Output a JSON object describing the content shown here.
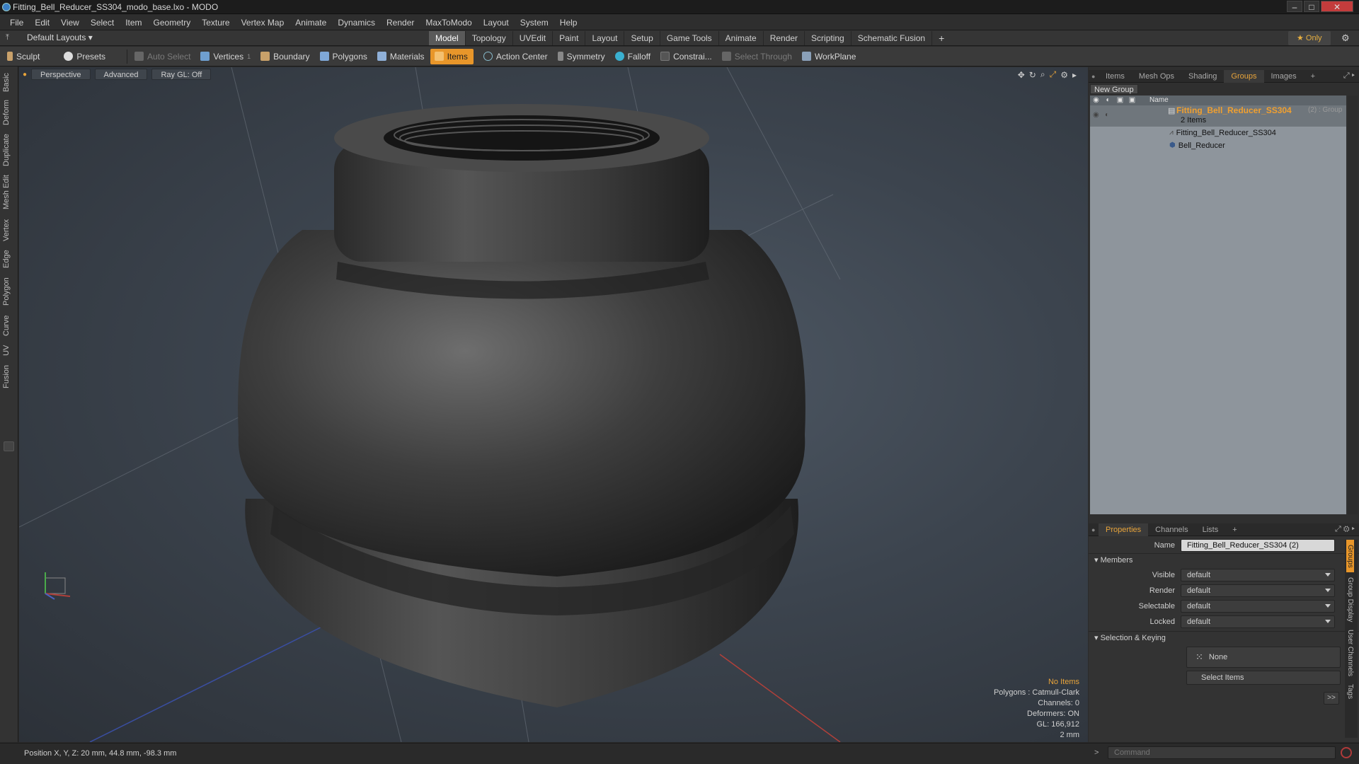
{
  "window": {
    "title": "Fitting_Bell_Reducer_SS304_modo_base.lxo - MODO",
    "min": "–",
    "max": "□",
    "close": "✕"
  },
  "menu": [
    "File",
    "Edit",
    "View",
    "Select",
    "Item",
    "Geometry",
    "Texture",
    "Vertex Map",
    "Animate",
    "Dynamics",
    "Render",
    "MaxToModo",
    "Layout",
    "System",
    "Help"
  ],
  "layoutbar": {
    "preset": "Default Layouts ▾",
    "tabs": [
      "Model",
      "Topology",
      "UVEdit",
      "Paint",
      "Layout",
      "Setup",
      "Game Tools",
      "Animate",
      "Render",
      "Scripting",
      "Schematic Fusion"
    ],
    "active": "Model",
    "plus": "+",
    "only": "★ Only"
  },
  "toolbar": {
    "sculpt": "Sculpt",
    "presets": "Presets",
    "auto_select": "Auto Select",
    "vertices": "Vertices",
    "vertices_badge": "1",
    "boundary": "Boundary",
    "polygons": "Polygons",
    "materials": "Materials",
    "items": "Items",
    "action_center": "Action Center",
    "symmetry": "Symmetry",
    "falloff": "Falloff",
    "constraints": "Constrai...",
    "select_through": "Select Through",
    "workplane": "WorkPlane"
  },
  "left_tabs": [
    "Basic",
    "Deform",
    "Duplicate",
    "Mesh Edit",
    "Vertex",
    "Edge",
    "Polygon",
    "Curve",
    "UV",
    "Fusion"
  ],
  "viewport": {
    "view": "Perspective",
    "shading": "Advanced",
    "raygl": "Ray GL: Off",
    "info": {
      "selection": "No Items",
      "polygons": "Polygons : Catmull-Clark",
      "channels": "Channels: 0",
      "deformers": "Deformers: ON",
      "gl": "GL: 166,912",
      "scale": "2 mm"
    }
  },
  "top_panel": {
    "tabs": [
      "Items",
      "Mesh Ops",
      "Shading",
      "Groups",
      "Images"
    ],
    "active": "Groups",
    "plus": "+",
    "new_group": "New Group",
    "col_name": "Name",
    "group": {
      "name": "Fitting_Bell_Reducer_SS304",
      "suffix": "(2) : Group",
      "count": "2 Items"
    },
    "children": [
      "Fitting_Bell_Reducer_SS304",
      "Bell_Reducer"
    ]
  },
  "props_panel": {
    "tabs": [
      "Properties",
      "Channels",
      "Lists"
    ],
    "active": "Properties",
    "plus": "+",
    "name_label": "Name",
    "name_value": "Fitting_Bell_Reducer_SS304 (2)",
    "members": "Members",
    "fields": [
      {
        "label": "Visible",
        "value": "default"
      },
      {
        "label": "Render",
        "value": "default"
      },
      {
        "label": "Selectable",
        "value": "default"
      },
      {
        "label": "Locked",
        "value": "default"
      }
    ],
    "sel_keying": "Selection & Keying",
    "none": "None",
    "select_items": "Select Items",
    "more": ">>",
    "side_tabs": [
      "Groups",
      "Group Display",
      "User Channels",
      "Tags"
    ]
  },
  "status": {
    "position": "Position X, Y, Z:  20 mm, 44.8 mm, -98.3 mm",
    "command_placeholder": "Command"
  }
}
